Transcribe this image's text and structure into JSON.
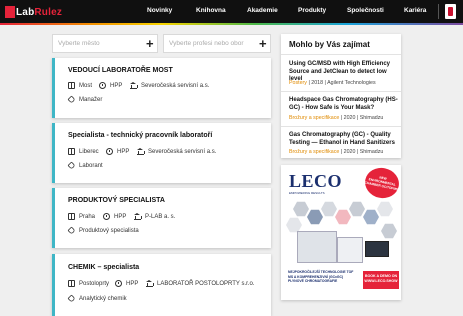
{
  "brand": {
    "name_part1": "Lab",
    "name_part2": "Rulez"
  },
  "nav": {
    "items": [
      {
        "label": "Novinky"
      },
      {
        "label": "Knihovna"
      },
      {
        "label": "Akademie"
      },
      {
        "label": "Produkty"
      },
      {
        "label": "Společnosti"
      },
      {
        "label": "Kariéra"
      }
    ]
  },
  "filters": {
    "location_placeholder": "Vyberte město",
    "profession_placeholder": "Vyberte profesi nebo obor"
  },
  "jobs": [
    {
      "title": "VEDOUCÍ LABORATOŘE MOST",
      "city": "Most",
      "type": "HPP",
      "company": "Severočeská servisní a.s.",
      "field": "Manažer"
    },
    {
      "title": "Specialista - technický pracovník laboratoří",
      "city": "Liberec",
      "type": "HPP",
      "company": "Severočeská servisní a.s.",
      "field": "Laborant"
    },
    {
      "title": "PRODUKTOVÝ SPECIALISTA",
      "city": "Praha",
      "type": "HPP",
      "company": "P-LAB a. s.",
      "field": "Produktový specialista"
    },
    {
      "title": "CHEMIK – specialista",
      "city": "Postoloprty",
      "type": "HPP",
      "company": "LABORATOŘ POSTOLOPRTY s.r.o.",
      "field": "Analytický chemik"
    }
  ],
  "sidebar": {
    "title": "Mohlo by Vás zajímat",
    "articles": [
      {
        "title": "Using GC/MSD with High Efficiency Source and JetClean to detect low level",
        "category": "Postery",
        "info": " | 2018 | Agilent Technologies"
      },
      {
        "title": "Headspace Gas Chromatography (HS-GC) - How Safe is Your Mask?",
        "category": "Brožury a specifikace",
        "info": " | 2020 | Shimadzu"
      },
      {
        "title": "Gas Chromatography (GC) - Quality Testing — Ethanol in Hand Sanitizers",
        "category": "Brožury a specifikace",
        "info": " | 2020 | Shimadzu"
      }
    ]
  },
  "ad": {
    "logo": "LECO",
    "tagline": "EMPOWERING RESULTS",
    "badge": "NEW ENVIRONMENTAL CHAMBER GC/TOFMS",
    "footer_text": "NEJPOKROČILEJŠÍ TECHNOLOGIE TOF MS A KOMPREHENZIVNÍ (GCxGC) PLYNOVÉ CHROMATOGRAFIE",
    "button": "BOOK A DEMO ON WWW.LECO.SHOW"
  },
  "colors": {
    "accent": "#e5233a",
    "card_border": "#3fb6c6",
    "category": "#e08a00",
    "nav_bg": "#101010"
  },
  "icons": [
    "map-icon",
    "clock-icon",
    "company-icon",
    "tag-icon",
    "plus-icon",
    "user-icon"
  ]
}
